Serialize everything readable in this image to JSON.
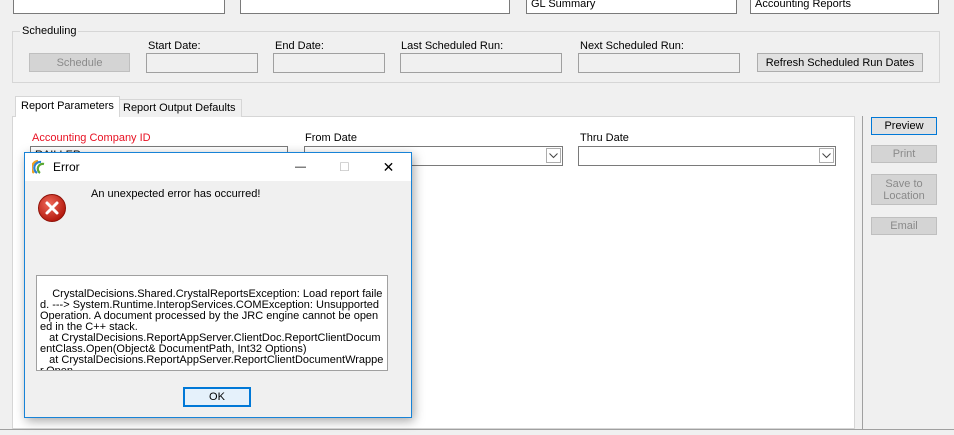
{
  "top_fields": {
    "report_name": "GL Summary",
    "category": "Accounting Reports"
  },
  "scheduling": {
    "group_label": "Scheduling",
    "schedule_button": "Schedule",
    "start_date_label": "Start Date:",
    "end_date_label": "End Date:",
    "last_run_label": "Last Scheduled Run:",
    "next_run_label": "Next Scheduled Run:",
    "refresh_button": "Refresh Scheduled Run Dates"
  },
  "tabs": [
    {
      "label": "Report Parameters"
    },
    {
      "label": "Report Output Defaults"
    }
  ],
  "parameters": {
    "company_label": "Accounting Company ID",
    "company_value": "RAILLER",
    "from_date_label": "From Date",
    "thru_date_label": "Thru Date"
  },
  "side_buttons": {
    "preview": "Preview",
    "print": "Print",
    "save": "Save to Location",
    "email": "Email"
  },
  "dialog": {
    "title": "Error",
    "message": "An unexpected error has occurred!",
    "details": "CrystalDecisions.Shared.CrystalReportsException: Load report failed. ---> System.Runtime.InteropServices.COMException: Unsupported Operation. A document processed by the JRC engine cannot be opened in the C++ stack.\n   at CrystalDecisions.ReportAppServer.ClientDoc.ReportClientDocumentClass.Open(Object& DocumentPath, Int32 Options)\n   at CrystalDecisions.ReportAppServer.ReportClientDocumentWrapper.Open",
    "ok_button": "OK",
    "minimize_glyph": "—",
    "maximize_glyph": "☐",
    "close_glyph": "✕"
  },
  "colors": {
    "required_label": "#e81123",
    "dialog_border": "#1883d7",
    "error_icon": "#c42b1c"
  }
}
